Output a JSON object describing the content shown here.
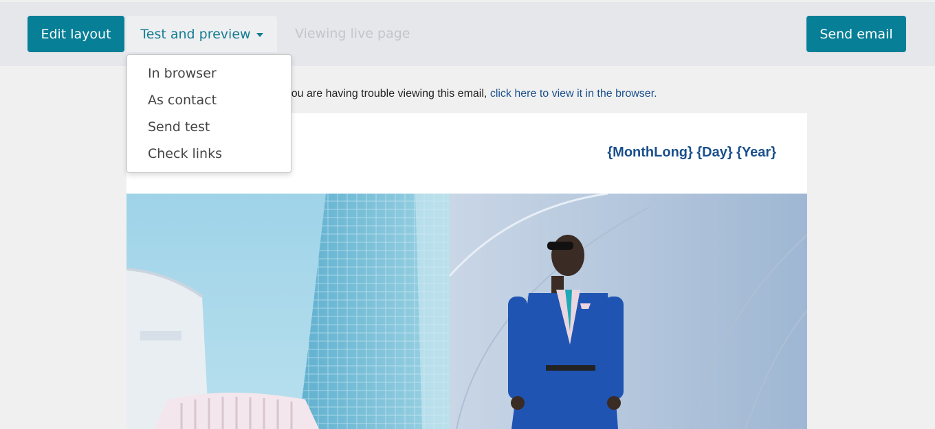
{
  "toolbar": {
    "edit_layout_label": "Edit layout",
    "test_preview_label": "Test and preview",
    "live_page_label": "Viewing live page",
    "send_email_label": "Send email"
  },
  "dropdown": {
    "items": [
      {
        "label": "In browser"
      },
      {
        "label": "As contact"
      },
      {
        "label": "Send test"
      },
      {
        "label": "Check links"
      }
    ]
  },
  "email": {
    "notice_prefix": "If you are having trouble viewing this email, ",
    "notice_link": "click here to view it in the browser.",
    "date_placeholder": "{MonthLong} {Day} {Year}"
  },
  "colors": {
    "primary": "#077f96",
    "link": "#1a4f8c"
  }
}
